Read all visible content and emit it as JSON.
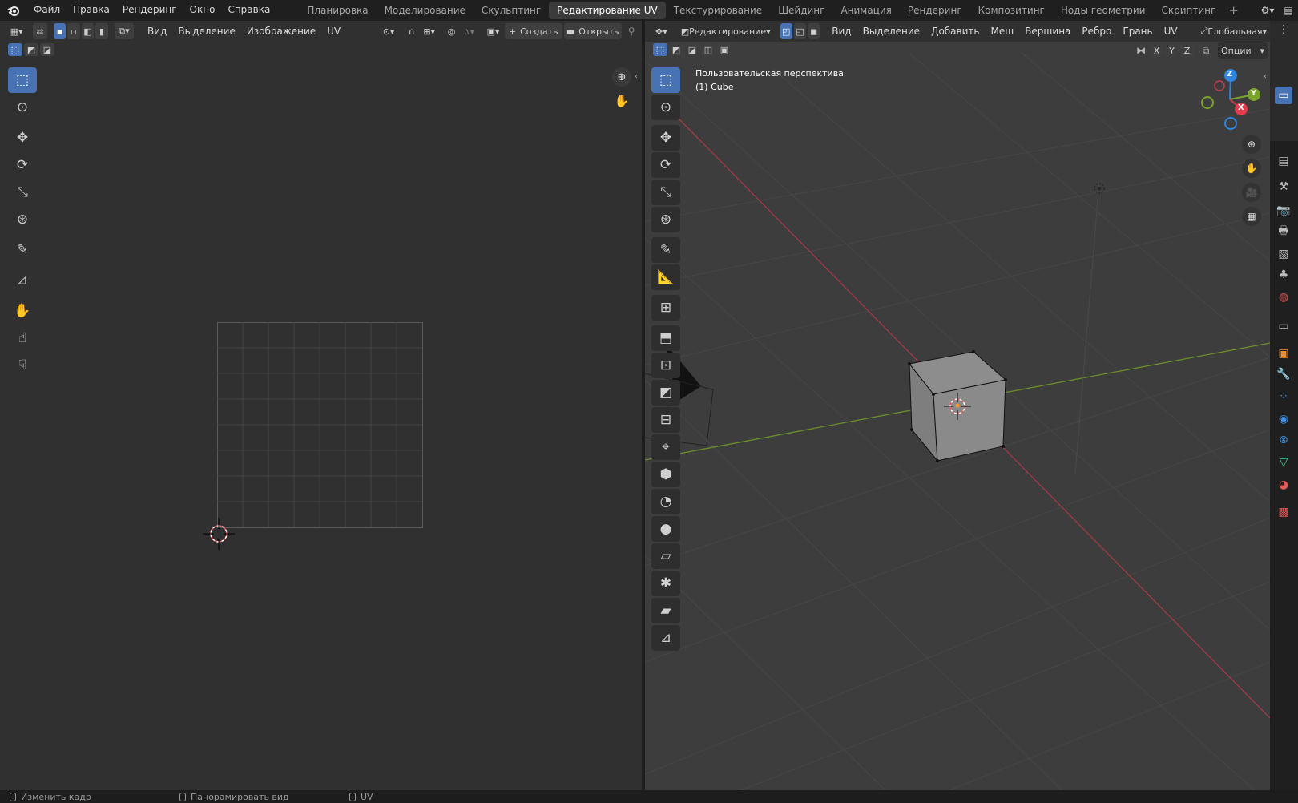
{
  "topbar": {
    "menus": [
      "Файл",
      "Правка",
      "Рендеринг",
      "Окно",
      "Справка"
    ],
    "workspaces": [
      {
        "label": "Планировка",
        "active": false
      },
      {
        "label": "Моделирование",
        "active": false
      },
      {
        "label": "Скульптинг",
        "active": false
      },
      {
        "label": "Редактирование UV",
        "active": true
      },
      {
        "label": "Текстурирование",
        "active": false
      },
      {
        "label": "Шейдинг",
        "active": false
      },
      {
        "label": "Анимация",
        "active": false
      },
      {
        "label": "Рендеринг",
        "active": false
      },
      {
        "label": "Композитинг",
        "active": false
      },
      {
        "label": "Ноды геометрии",
        "active": false
      },
      {
        "label": "Скриптинг",
        "active": false
      }
    ],
    "add_tab": "+"
  },
  "uv_editor": {
    "menus": [
      "Вид",
      "Выделение",
      "Изображение",
      "UV"
    ],
    "new_button": "Создать",
    "open_button": "Открыть",
    "new_icon": "+",
    "tools": [
      "select-box-icon",
      "cursor-icon",
      "move-icon",
      "rotate-icon",
      "scale-icon",
      "transform-icon",
      "annotate-icon",
      "rip-icon",
      "grab-icon",
      "relax-icon",
      "pinch-icon"
    ]
  },
  "viewport": {
    "mode": "Редактирование",
    "menus": [
      "Вид",
      "Выделение",
      "Добавить",
      "Меш",
      "Вершина",
      "Ребро",
      "Грань",
      "UV"
    ],
    "orientation": "Глобальная",
    "axes_buttons": [
      "X",
      "Y",
      "Z"
    ],
    "options": "Опции",
    "overlay_title": "Пользовательская перспектива",
    "overlay_object": "(1) Cube",
    "gizmo": {
      "z": "Z",
      "y": "Y",
      "x": "X"
    }
  },
  "statusbar": {
    "items": [
      "Изменить кадр",
      "Панорамировать вид",
      "UV"
    ]
  },
  "colors": {
    "accent": "#4772b3",
    "x_axis": "#c43c4e",
    "y_axis": "#7aa32c",
    "z_axis": "#2f85e0",
    "panel_bg": "#303030",
    "topbar_bg": "#1f1f1f"
  }
}
